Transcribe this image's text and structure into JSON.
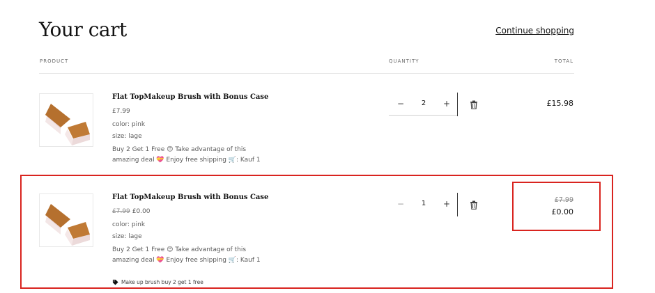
{
  "page": {
    "title": "Your cart",
    "continue_link": "Continue shopping"
  },
  "headers": {
    "product": "PRODUCT",
    "quantity": "QUANTITY",
    "total": "TOTAL"
  },
  "items": [
    {
      "name": "Flat TopMakeup Brush with Bonus Case",
      "price": "£7.99",
      "price_original": "",
      "color": "color: pink",
      "size": "size: lage",
      "promo": "Buy 2 Get 1 Free 😍 Take advantage of this amazing deal 💝 Enjoy free shipping 🛒: Kauf 1",
      "quantity": "2",
      "total": "£15.98",
      "total_original": "",
      "discount": ""
    },
    {
      "name": "Flat TopMakeup Brush with Bonus Case",
      "price": "£0.00",
      "price_original": "£7.99",
      "color": "color: pink",
      "size": "size: lage",
      "promo": "Buy 2 Get 1 Free 😍 Take advantage of this amazing deal 💝 Enjoy free shipping 🛒: Kauf 1",
      "quantity": "1",
      "total": "£0.00",
      "total_original": "£7.99",
      "discount": "Make up brush buy 2 get 1 free"
    }
  ],
  "controls": {
    "minus": "−",
    "plus": "+"
  },
  "colors": {
    "highlight": "#d9241f",
    "text": "#121212",
    "muted": "#5a5a5a"
  }
}
